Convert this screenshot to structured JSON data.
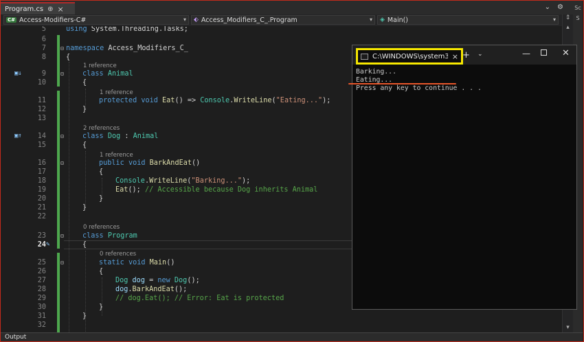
{
  "tab": {
    "title": "Program.cs",
    "pin": "⊕",
    "close": "×"
  },
  "navbar": {
    "project": "Access-Modifiers-C#",
    "project_badge": "C#",
    "class": "Access_Modifiers_C_.Program",
    "method": "Main()"
  },
  "lines": [
    {
      "n": "5"
    },
    {
      "n": "6"
    },
    {
      "n": "7"
    },
    {
      "n": "8"
    },
    {
      "n": "9"
    },
    {
      "n": "10"
    },
    {
      "n": "11"
    },
    {
      "n": "12"
    },
    {
      "n": "13"
    },
    {
      "n": "14"
    },
    {
      "n": "15"
    },
    {
      "n": "16"
    },
    {
      "n": "17"
    },
    {
      "n": "18"
    },
    {
      "n": "19"
    },
    {
      "n": "20"
    },
    {
      "n": "21"
    },
    {
      "n": "22"
    },
    {
      "n": "23"
    },
    {
      "n": "24"
    },
    {
      "n": "25"
    },
    {
      "n": "26"
    },
    {
      "n": "27"
    },
    {
      "n": "28"
    },
    {
      "n": "29"
    },
    {
      "n": "30"
    },
    {
      "n": "31"
    },
    {
      "n": "32"
    }
  ],
  "code": {
    "using": "using",
    "using_ns": " System.Threading.Tasks;",
    "namespace_kw": "namespace",
    "namespace_name": " Access_Modifiers_C_",
    "class_kw": "class",
    "animal": "Animal",
    "dog": "Dog",
    "program": "Program",
    "protected": "protected",
    "void": "void",
    "public": "public",
    "static": "static",
    "new": "new",
    "eat": "Eat",
    "barkandeat": "BarkAndEat",
    "main": "Main",
    "console": "Console",
    "writeline": "WriteLine",
    "eating_str": "\"Eating...\"",
    "barking_str": "\"Barking...\"",
    "arrow": "() => ",
    "dot": ".",
    "paren_end": ");",
    "parens": "()",
    "colon": " : ",
    "brace_open": "{",
    "brace_close": "}",
    "eat_call_end": "(); ",
    "comment_eat": "// Accessible because Dog inherits Animal",
    "dog_var": "dog",
    "eq": " = ",
    "new_dog_end": "();",
    "bark_call_end": "();",
    "comment_main": "// dog.Eat(); // Error: Eat is protected",
    "refs_1": "1 reference",
    "refs_2": "2 references",
    "refs_0": "0 references"
  },
  "console": {
    "title": "C:\\WINDOWS\\system3",
    "output": [
      "Barking...",
      "Eating...",
      "Press any key to continue . . ."
    ]
  },
  "bottom": {
    "label": "Output"
  },
  "right_strip": [
    "Sc",
    "S"
  ]
}
